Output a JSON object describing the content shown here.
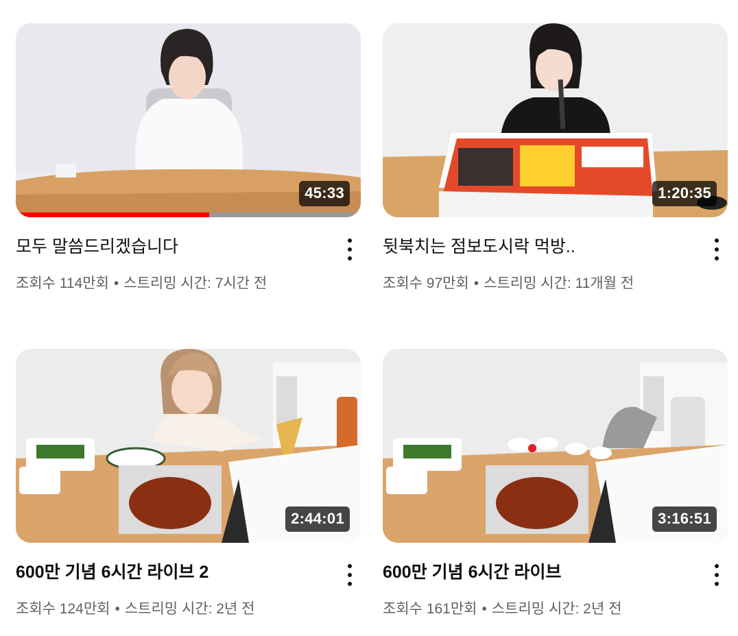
{
  "colors": {
    "progress": "#ff0000",
    "title": "#0f0f0f",
    "meta": "#606060",
    "badge_bg": "rgba(0,0,0,0.72)"
  },
  "icons": {
    "more": "more-vert-icon"
  },
  "videos": [
    {
      "title": "모두 말씀드리겠습니다",
      "views": "조회수 114만회",
      "streamed": "스트리밍 시간: 7시간 전",
      "duration": "45:33",
      "watched_fraction": 0.56
    },
    {
      "title": "뒷북치는 점보도시락 먹방..",
      "views": "조회수 97만회",
      "streamed": "스트리밍 시간: 11개월 전",
      "duration": "1:20:35"
    },
    {
      "title": "600만 기념 6시간 라이브 2",
      "views": "조회수 124만회",
      "streamed": "스트리밍 시간: 2년 전",
      "duration": "2:44:01"
    },
    {
      "title": "600만 기념 6시간 라이브",
      "views": "조회수 161만회",
      "streamed": "스트리밍 시간: 2년 전",
      "duration": "3:16:51"
    }
  ]
}
